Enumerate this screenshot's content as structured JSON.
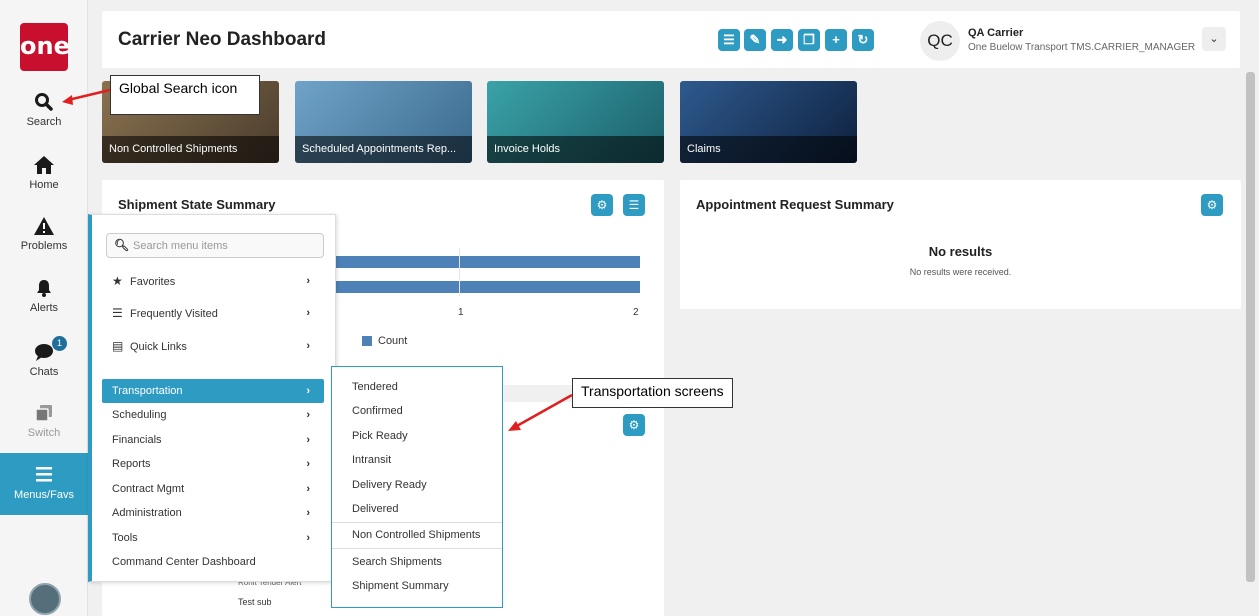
{
  "logo": {
    "text": "one"
  },
  "nav": {
    "search": "Search",
    "home": "Home",
    "problems": "Problems",
    "alerts": "Alerts",
    "chats": "Chats",
    "chats_badge": "1",
    "switch": "Switch",
    "menus": "Menus/Favs"
  },
  "header": {
    "title": "Carrier Neo Dashboard",
    "initials": "QC",
    "user_name": "QA Carrier",
    "user_org": "One Buelow Transport TMS.CARRIER_MANAGER"
  },
  "tiles": [
    {
      "label": "Non Controlled Shipments",
      "color": "#6b5a3f"
    },
    {
      "label": "Scheduled Appointments Rep...",
      "color": "#4f7fa0"
    },
    {
      "label": "Invoice Holds",
      "color": "#2b7f86"
    },
    {
      "label": "Claims",
      "color": "#1c3e6a"
    }
  ],
  "shipment_card": {
    "title": "Shipment State Summary",
    "tick_1": "1",
    "tick_2": "2",
    "legend": "Count"
  },
  "appointment_card": {
    "title": "Appointment Request Summary",
    "no_results": "No results",
    "no_results_sub": "No results were received."
  },
  "bottom_card": {
    "row_1": "Ronit Tender Alert",
    "row_2": "Test sub"
  },
  "menu": {
    "search_placeholder": "Search menu items",
    "favorites": "Favorites",
    "frequently_visited": "Frequently Visited",
    "quick_links": "Quick Links",
    "items": [
      "Transportation",
      "Scheduling",
      "Financials",
      "Reports",
      "Contract Mgmt",
      "Administration",
      "Tools"
    ],
    "command_center": "Command Center Dashboard"
  },
  "submenu": {
    "items": [
      "Tendered",
      "Confirmed",
      "Pick Ready",
      "Intransit",
      "Delivery Ready",
      "Delivered",
      "Non Controlled Shipments",
      "Search Shipments",
      "Shipment Summary"
    ]
  },
  "annotations": {
    "global_search": "Global Search icon",
    "transportation": "Transportation screens"
  }
}
